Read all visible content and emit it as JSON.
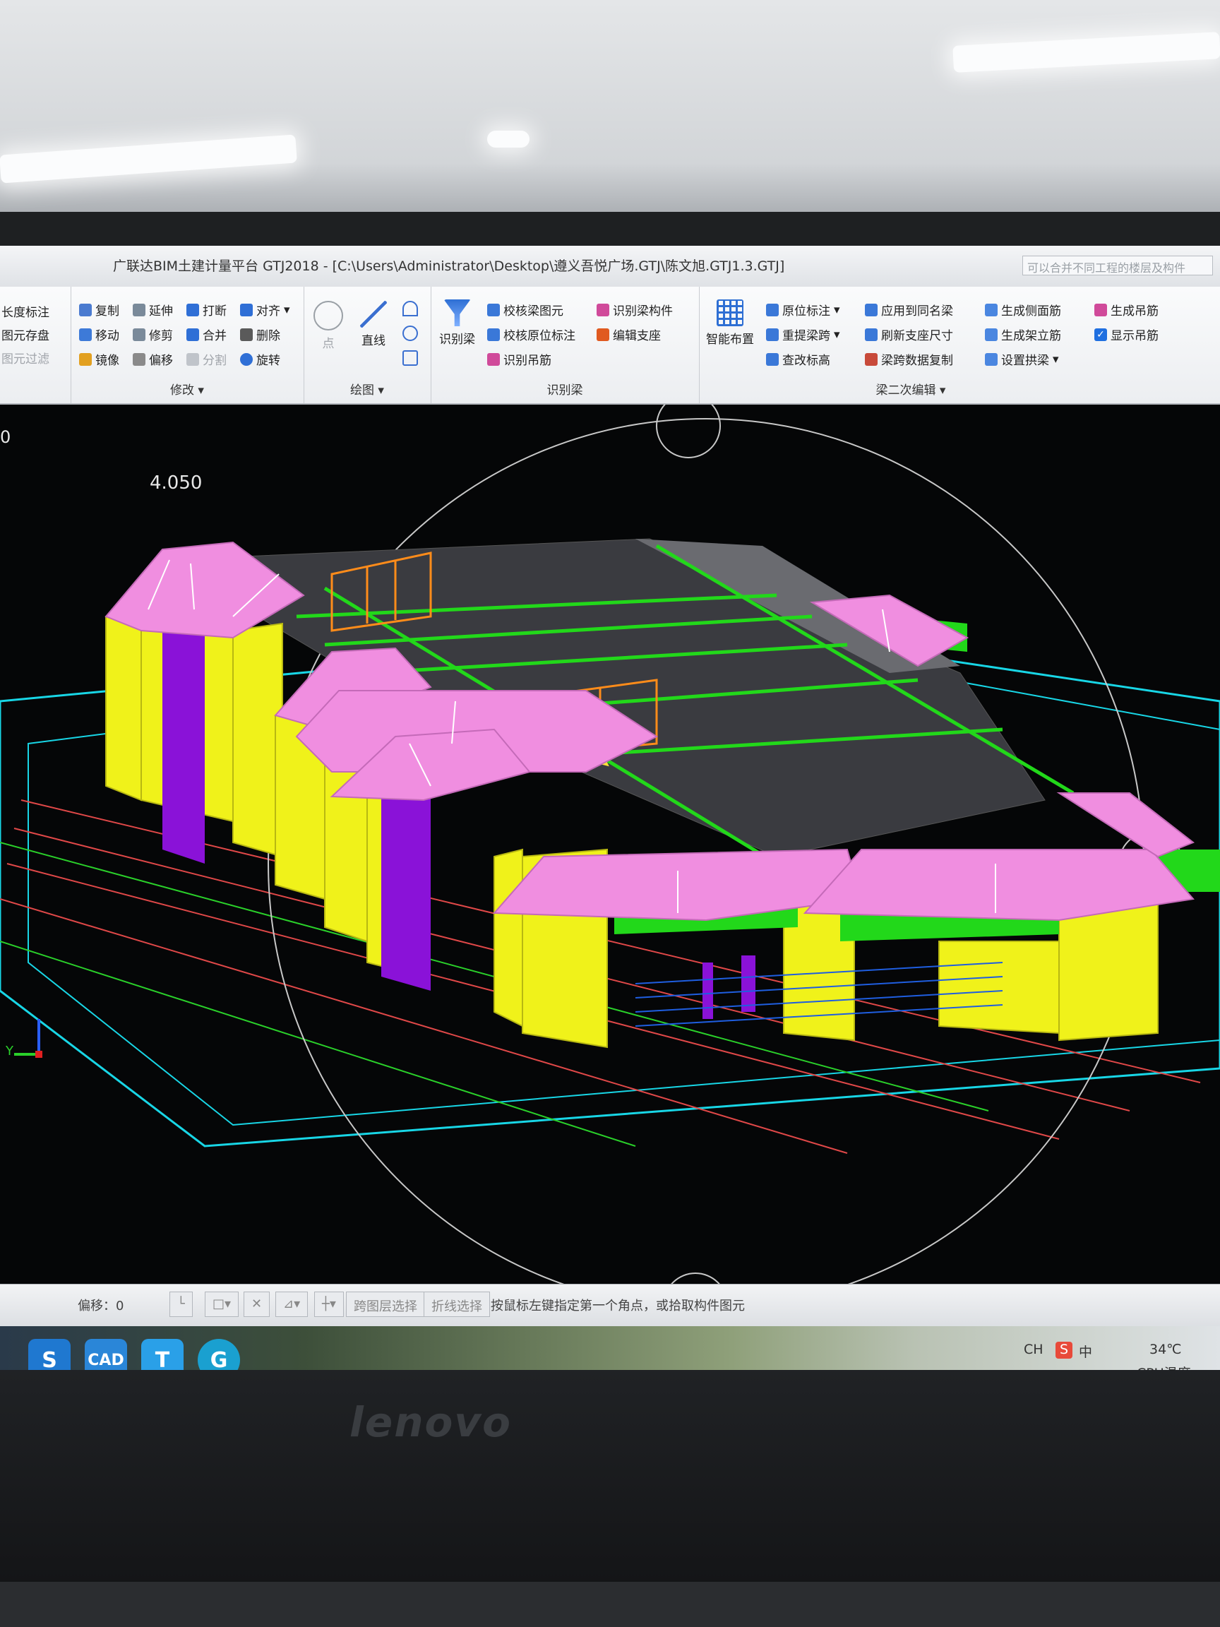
{
  "window": {
    "title": "广联达BIM土建计量平台 GTJ2018 - [C:\\Users\\Administrator\\Desktop\\遵义吾悦广场.GTJ\\陈文旭.GTJ1.3.GTJ]",
    "hint": "可以合并不同工程的楼层及构件"
  },
  "ribbon": {
    "left": {
      "length_mark": "长度标注",
      "element_save": "图元存盘",
      "element_filter": "图元过滤"
    },
    "modify": {
      "label": "修改",
      "copy": "复制",
      "extend": "延伸",
      "break": "打断",
      "align": "对齐",
      "move": "移动",
      "trim": "修剪",
      "merge": "合并",
      "delete": "删除",
      "mirror": "镜像",
      "offset": "偏移",
      "split": "分割",
      "rotate": "旋转"
    },
    "draw": {
      "label": "绘图",
      "point": "点",
      "line": "直线"
    },
    "recognize": {
      "label": "识别梁",
      "recognize_beam": "识别梁",
      "check_beam": "校核梁图元",
      "check_origin": "校核原位标注",
      "recognize_hanger": "识别吊筋",
      "recognize_beam_comp": "识别梁构件",
      "edit_support": "编辑支座"
    },
    "second_edit": {
      "label": "梁二次编辑",
      "smart_layout": "智能布置",
      "origin_mark": "原位标注",
      "re_span": "重提梁跨",
      "check_elev": "查改标高",
      "apply_same": "应用到同名梁",
      "refresh_support": "刷新支座尺寸",
      "span_copy": "梁跨数据复制",
      "gen_side_rebar": "生成侧面筋",
      "gen_stirrup": "生成架立筋",
      "set_arch": "设置拱梁",
      "gen_hanger": "生成吊筋",
      "show_hanger": "显示吊筋"
    }
  },
  "viewport": {
    "left_readout": "0",
    "elevation_readout": "4.050",
    "axis_y": "Y"
  },
  "statusbar": {
    "offset": "偏移：0",
    "cross_layer": "跨图层选择",
    "polyline": "折线选择",
    "prompt": "按鼠标左键指定第一个角点，或拾取构件图元"
  },
  "taskbar": {
    "icons": [
      "S",
      "CAD",
      "T",
      "G"
    ],
    "lang": "CH",
    "ime": "中",
    "temp": "34℃",
    "temp_label": "CPU温度"
  },
  "monitor": {
    "brand": "lenovo"
  },
  "colors": {
    "roof": "#f08ee0",
    "wall": "#f0f21a",
    "beam": "#22d81a",
    "column": "#8a12d8",
    "slab": "#3a3b40",
    "grid": "#18d6e6",
    "rebar": "#ff7a00"
  }
}
